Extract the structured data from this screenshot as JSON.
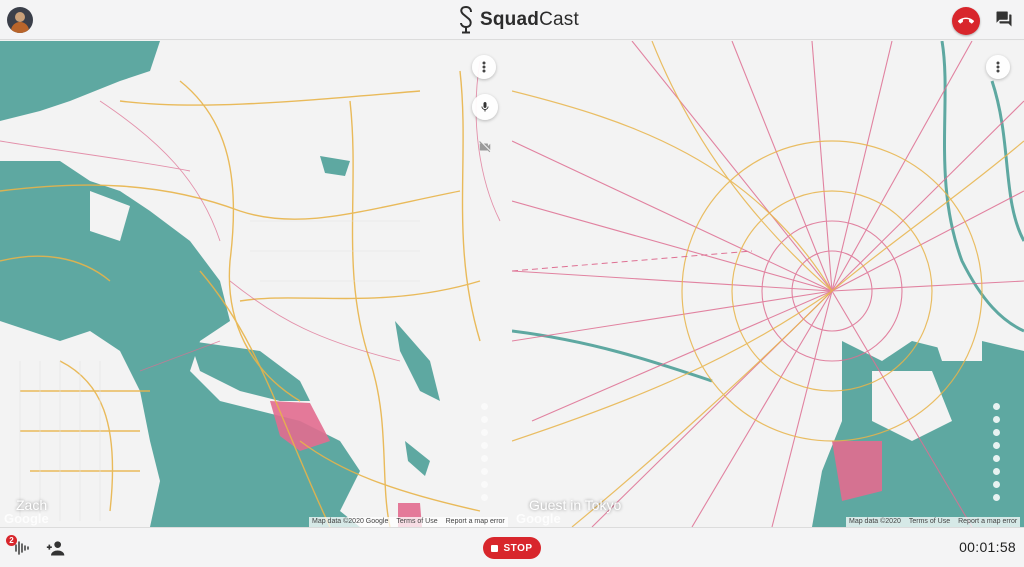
{
  "app": {
    "brand_bold": "Squad",
    "brand_light": "Cast"
  },
  "colors": {
    "accent": "#d8262c",
    "water": "#5ea8a1",
    "roads_major": "#e8b44a",
    "roads_rail": "#de6f92",
    "land": "#f3f3f3"
  },
  "header": {
    "avatar_icon": "user-avatar",
    "hangup_icon": "phone-hangup-icon",
    "chat_icon": "chat-bubble-icon"
  },
  "tiles": [
    {
      "id": "left",
      "participant": "Zach",
      "watermark": "Google",
      "attribution": [
        "Map data ©2020 Google",
        "Terms of Use",
        "Report a map error"
      ],
      "controls": [
        "more-options-icon",
        "microphone-icon",
        "camera-off-icon"
      ]
    },
    {
      "id": "right",
      "participant": "Guest in Tokyo",
      "watermark": "Google",
      "attribution": [
        "Map data ©2020",
        "Terms of Use",
        "Report a map error"
      ],
      "controls": [
        "more-options-icon"
      ]
    }
  ],
  "footer": {
    "audio_badge": "2",
    "audio_icon": "sound-wave-icon",
    "add_guest_icon": "add-person-icon",
    "stop_label": "STOP",
    "timer": "00:01:58"
  }
}
